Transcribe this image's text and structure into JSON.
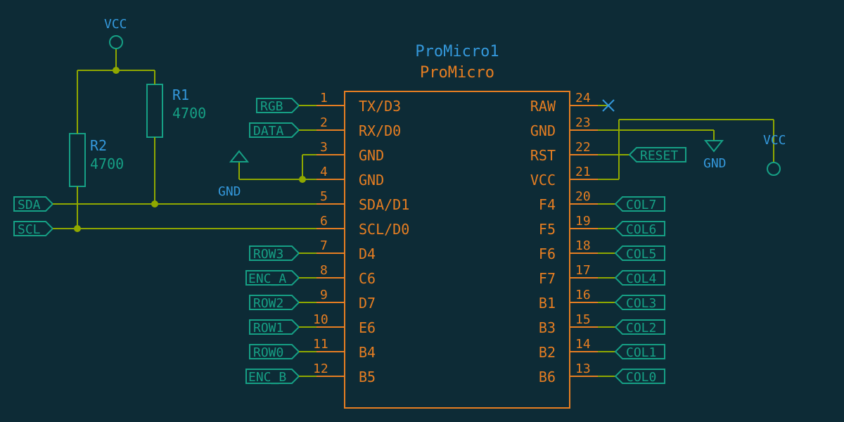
{
  "component": {
    "ref": "ProMicro1",
    "type": "ProMicro",
    "left_pins": [
      {
        "num": "1",
        "name": "TX/D3"
      },
      {
        "num": "2",
        "name": "RX/D0"
      },
      {
        "num": "3",
        "name": "GND"
      },
      {
        "num": "4",
        "name": "GND"
      },
      {
        "num": "5",
        "name": "SDA/D1"
      },
      {
        "num": "6",
        "name": "SCL/D0"
      },
      {
        "num": "7",
        "name": "D4"
      },
      {
        "num": "8",
        "name": "C6"
      },
      {
        "num": "9",
        "name": "D7"
      },
      {
        "num": "10",
        "name": "E6"
      },
      {
        "num": "11",
        "name": "B4"
      },
      {
        "num": "12",
        "name": "B5"
      }
    ],
    "right_pins": [
      {
        "num": "24",
        "name": "RAW"
      },
      {
        "num": "23",
        "name": "GND"
      },
      {
        "num": "22",
        "name": "RST"
      },
      {
        "num": "21",
        "name": "VCC"
      },
      {
        "num": "20",
        "name": "F4"
      },
      {
        "num": "19",
        "name": "F5"
      },
      {
        "num": "18",
        "name": "F6"
      },
      {
        "num": "17",
        "name": "F7"
      },
      {
        "num": "16",
        "name": "B1"
      },
      {
        "num": "15",
        "name": "B3"
      },
      {
        "num": "14",
        "name": "B2"
      },
      {
        "num": "13",
        "name": "B6"
      }
    ]
  },
  "resistors": {
    "r1": {
      "ref": "R1",
      "value": "4700"
    },
    "r2": {
      "ref": "R2",
      "value": "4700"
    }
  },
  "power": {
    "vcc_left": "VCC",
    "gnd_left": "GND",
    "vcc_right": "VCC",
    "gnd_right": "GND"
  },
  "net_labels": {
    "left": [
      "RGB",
      "DATA",
      "",
      "",
      "SDA",
      "SCL",
      "ROW3",
      "ENC_A",
      "ROW2",
      "ROW1",
      "ROW0",
      "ENC_B"
    ],
    "right": [
      "",
      "",
      "RESET",
      "",
      "COL7",
      "COL6",
      "COL5",
      "COL4",
      "COL3",
      "COL2",
      "COL1",
      "COL0"
    ]
  }
}
